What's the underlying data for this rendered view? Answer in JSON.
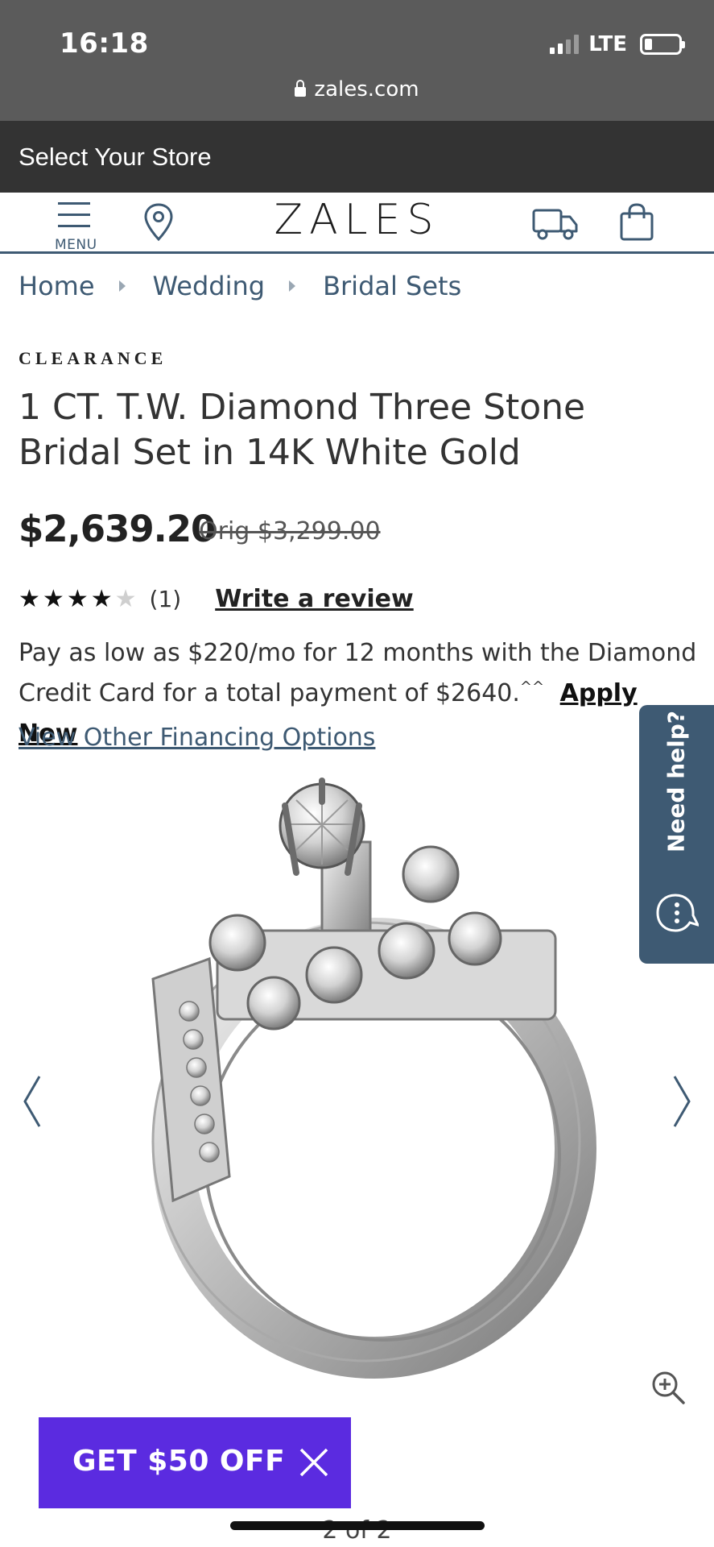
{
  "status_bar": {
    "time": "16:18",
    "network": "LTE",
    "url": "zales.com"
  },
  "store_bar": {
    "label": "Select Your Store"
  },
  "header": {
    "menu_label": "MENU",
    "logo": "ZALES",
    "icons": [
      "menu-icon",
      "location-pin-icon",
      "truck-icon",
      "shopping-bag-icon"
    ],
    "accent_color": "#3e5a73"
  },
  "breadcrumb": {
    "items": [
      "Home",
      "Wedding",
      "Bridal Sets"
    ]
  },
  "product": {
    "badge": "CLEARANCE",
    "title": "1 CT. T.W. Diamond Three Stone Bridal Set in 14K White Gold",
    "price": "$2,639.20",
    "original_price": "Orig $3,299.00",
    "rating": 4,
    "rating_max": 5,
    "review_count": "(1)",
    "write_review": "Write a review"
  },
  "financing": {
    "text": "Pay as low as $220/mo for 12 months with the Diamond Credit Card for a total payment of $2640.",
    "footnote": "^^",
    "apply_label": "Apply Now",
    "other_options": "View Other Financing Options"
  },
  "gallery": {
    "pager": "2 of 2",
    "prev_icon": "chevron-left-icon",
    "next_icon": "chevron-right-icon",
    "zoom_icon": "zoom-in-icon"
  },
  "help_tab": {
    "label": "Need help?",
    "icon": "chat-bubble-icon"
  },
  "promo": {
    "label": "GET $50 OFF",
    "color": "#5b2be0",
    "close_icon": "close-icon"
  }
}
